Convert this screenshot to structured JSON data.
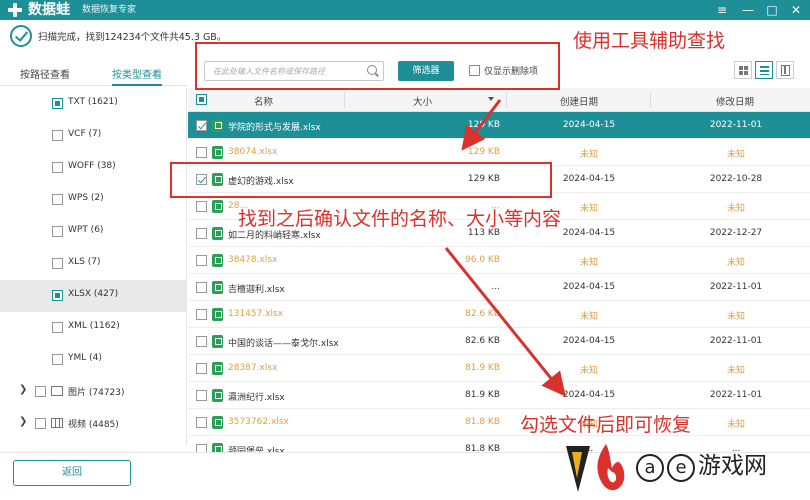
{
  "app": {
    "name": "数据蛙",
    "subtitle": "数据恢复专家",
    "window_controls": [
      "≡",
      "—",
      "□",
      "✕"
    ]
  },
  "status": {
    "text": "扫描完成，找到124234个文件共45.3 GB。"
  },
  "tabs": [
    {
      "label": "按路径查看",
      "active": false
    },
    {
      "label": "按类型查看",
      "active": true
    }
  ],
  "toolbar": {
    "search_placeholder": "在此处输入文件名称或保存路径",
    "filter_label": "筛选器",
    "deleted_only_label": "仅显示删除项"
  },
  "categories": [
    {
      "label": "TXT (1621)",
      "checked": true
    },
    {
      "label": "VCF (7)",
      "checked": false
    },
    {
      "label": "WOFF (38)",
      "checked": false
    },
    {
      "label": "WPS (2)",
      "checked": false
    },
    {
      "label": "WPT (6)",
      "checked": false
    },
    {
      "label": "XLS (7)",
      "checked": false
    },
    {
      "label": "XLSX (427)",
      "checked": true,
      "selected": true
    },
    {
      "label": "XML (1162)",
      "checked": false
    },
    {
      "label": "YML (4)",
      "checked": false
    },
    {
      "label": "图片 (74723)",
      "group": true,
      "icon": "folder-icon"
    },
    {
      "label": "视频 (4485)",
      "group": true,
      "icon": "video-icon"
    }
  ],
  "table": {
    "columns": [
      "名称",
      "大小",
      "创建日期",
      "修改日期"
    ],
    "rows": [
      {
        "name": "学院的形式与发展.xlsx",
        "size": "129 KB",
        "created": "2024-04-15",
        "modified": "2022-11-01",
        "checked": true,
        "selected": true
      },
      {
        "name": "38074.xlsx",
        "size": "129 KB",
        "created": "未知",
        "modified": "未知",
        "unknown": true
      },
      {
        "name": "虚幻的游戏.xlsx",
        "size": "129 KB",
        "created": "2024-04-15",
        "modified": "2022-10-28",
        "checked": true
      },
      {
        "name": "28...",
        "size": "...",
        "created": "未知",
        "modified": "未知",
        "unknown": true
      },
      {
        "name": "如二月的料峭轻寒.xlsx",
        "size": "113 KB",
        "created": "2024-04-15",
        "modified": "2022-12-27"
      },
      {
        "name": "38478.xlsx",
        "size": "96.0 KB",
        "created": "未知",
        "modified": "未知",
        "unknown": true
      },
      {
        "name": "吉檀迦利.xlsx",
        "size": "...",
        "created": "2024-04-15",
        "modified": "2022-11-01"
      },
      {
        "name": "131457.xlsx",
        "size": "82.6 KB",
        "created": "未知",
        "modified": "未知",
        "unknown": true
      },
      {
        "name": "中国的谈话——泰戈尔.xlsx",
        "size": "82.6 KB",
        "created": "2024-04-15",
        "modified": "2022-11-01"
      },
      {
        "name": "28387.xlsx",
        "size": "81.9 KB",
        "created": "未知",
        "modified": "未知",
        "unknown": true
      },
      {
        "name": "瀛洲纪行.xlsx",
        "size": "81.9 KB",
        "created": "2024-04-15",
        "modified": "2022-11-01"
      },
      {
        "name": "3573762.xlsx",
        "size": "81.8 KB",
        "created": "未知",
        "modified": "未知",
        "unknown": true
      },
      {
        "name": "颈园堡垒.xlsx",
        "size": "81.8 KB",
        "created": "...",
        "modified": "..."
      }
    ]
  },
  "bottom": {
    "back_label": "返回"
  },
  "annotations": {
    "top": "使用工具辅助查找",
    "middle": "找到之后确认文件的名称、大小等内容",
    "bottom": "勾选文件后即可恢复"
  },
  "watermark": {
    "a": "a",
    "e": "e",
    "text": "游戏网"
  },
  "colors": {
    "accent": "#1e8f96",
    "annotation": "#d9312c",
    "unknown": "#e0a040"
  }
}
